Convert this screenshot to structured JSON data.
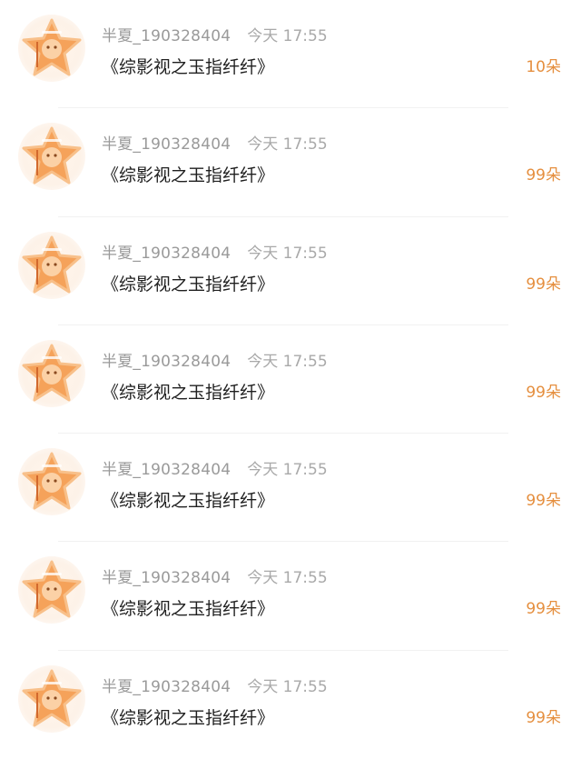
{
  "messages": [
    {
      "username": "半夏_190328404",
      "time": "今天 17:55",
      "title": "《综影视之玉指纤纤》",
      "count": "10朵"
    },
    {
      "username": "半夏_190328404",
      "time": "今天 17:55",
      "title": "《综影视之玉指纤纤》",
      "count": "99朵"
    },
    {
      "username": "半夏_190328404",
      "time": "今天 17:55",
      "title": "《综影视之玉指纤纤》",
      "count": "99朵"
    },
    {
      "username": "半夏_190328404",
      "time": "今天 17:55",
      "title": "《综影视之玉指纤纤》",
      "count": "99朵"
    },
    {
      "username": "半夏_190328404",
      "time": "今天 17:55",
      "title": "《综影视之玉指纤纤》",
      "count": "99朵"
    },
    {
      "username": "半夏_190328404",
      "time": "今天 17:55",
      "title": "《综影视之玉指纤纤》",
      "count": "99朵"
    },
    {
      "username": "半夏_190328404",
      "time": "今天 17:55",
      "title": "《综影视之玉指纤纤》",
      "count": "99朵"
    }
  ],
  "colors": {
    "accent": "#e58f3f",
    "username": "#9a9a9a",
    "time": "#a9a9a9",
    "title": "#1f1f1f",
    "divider": "#f1f1f1"
  },
  "icons": {
    "avatar": "orange-star-avatar-icon"
  }
}
